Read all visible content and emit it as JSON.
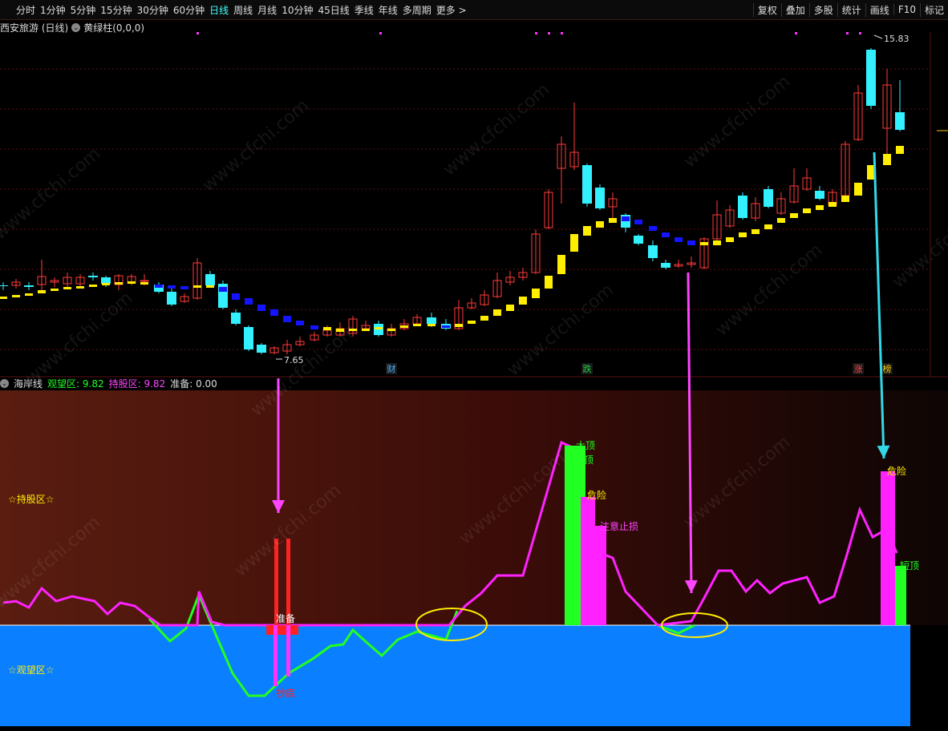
{
  "toolbar": {
    "left_items": [
      "分时",
      "1分钟",
      "5分钟",
      "15分钟",
      "30分钟",
      "60分钟",
      "日线",
      "周线",
      "月线",
      "10分钟",
      "45日线",
      "季线",
      "年线",
      "多周期",
      "更多 >"
    ],
    "active": "日线",
    "right_items": [
      "复权",
      "叠加",
      "多股",
      "统计",
      "画线",
      "F10",
      "标记"
    ]
  },
  "stock": {
    "name": "西安旅游 (日线)",
    "indicator": "黄绿柱(0,0,0)"
  },
  "price": {
    "high_label": "15.83",
    "low_label": "7.65"
  },
  "events": [
    {
      "label": "财",
      "color": "#4ab0ff"
    },
    {
      "label": "跌",
      "color": "#22cc44"
    },
    {
      "label": "涨",
      "color": "#ff4444"
    },
    {
      "label": "榜",
      "color": "#ffcc00"
    }
  ],
  "lower": {
    "name": "海岸线",
    "watch_label": "观望区:",
    "watch_value": "9.82",
    "hold_label": "持股区:",
    "hold_value": "9.82",
    "ready_label": "准备:",
    "ready_value": "0.00",
    "zone_hold": "☆持股区☆",
    "zone_watch": "☆观望区☆",
    "tags": {
      "big_top": "大顶",
      "top": "顶",
      "danger1": "危险",
      "stop_loss": "注意止损",
      "danger2": "危险",
      "short_top": "短顶",
      "prepare": "准备",
      "bottom": "抄底"
    }
  },
  "watermark": "www.cfchi.com",
  "colors": {
    "up": "#ff3a3a",
    "down_cyan": "#33f0ff",
    "yellow_bar": "#ffee00",
    "blue_bar": "#1414ff",
    "magenta": "#ff22ff",
    "green": "#22ff22",
    "water": "#0a7fff"
  }
}
